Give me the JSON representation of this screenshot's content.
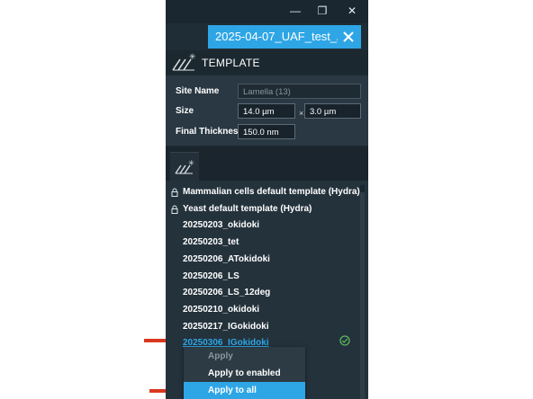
{
  "window": {
    "minimize_glyph": "—",
    "maximize_glyph": "❐",
    "close_glyph": "✕"
  },
  "document_tab": {
    "label": "2025-04-07_UAF_test_A..."
  },
  "template_section": {
    "title": "TEMPLATE",
    "logo_icon": "ii-logo-icon"
  },
  "form": {
    "site_name": {
      "label": "Site Name",
      "value": "Lamella (13)"
    },
    "size": {
      "label": "Size",
      "width": "14.0 µm",
      "separator": "×",
      "height": "3.0 µm"
    },
    "final_thickness": {
      "label": "Final Thickness",
      "value": "150.0 nm"
    }
  },
  "template_list": [
    {
      "label": "Mammalian cells default template (Hydra)",
      "locked": true
    },
    {
      "label": "Yeast default template (Hydra)",
      "locked": true
    },
    {
      "label": "20250203_okidoki",
      "locked": false
    },
    {
      "label": "20250203_tet",
      "locked": false
    },
    {
      "label": "20250206_ATokidoki",
      "locked": false
    },
    {
      "label": "20250206_LS",
      "locked": false
    },
    {
      "label": "20250206_LS_12deg",
      "locked": false
    },
    {
      "label": "20250210_okidoki",
      "locked": false
    },
    {
      "label": "20250217_IGokidoki",
      "locked": false
    },
    {
      "label": "20250306_IGokidoki",
      "locked": false,
      "selected": true
    }
  ],
  "context_menu": {
    "items": [
      {
        "label": "Apply",
        "enabled": false
      },
      {
        "label": "Apply to enabled",
        "enabled": true
      },
      {
        "label": "Apply to all",
        "enabled": true,
        "highlighted": true
      }
    ]
  },
  "colors": {
    "accent": "#2ea6e6",
    "panel_bg": "#1d2a33",
    "arrow": "#d9381e",
    "check": "#5cb85c"
  }
}
